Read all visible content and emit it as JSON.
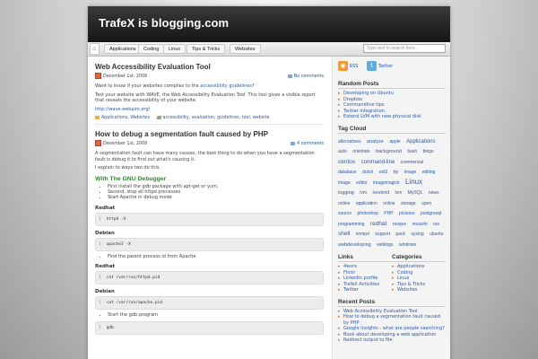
{
  "site": {
    "title": "TrafeX is blogging.com"
  },
  "nav": {
    "home_icon": "home-icon",
    "items": [
      "Applications",
      "Coding",
      "Linux",
      "Tips & Tricks",
      "Websites"
    ],
    "search_placeholder": "Type text to search here..."
  },
  "posts": [
    {
      "title": "Web Accessibility Evaluation Tool",
      "date": "December 1st, 2009",
      "comments": "No comments",
      "p1_before": "Want to know if your websites complies to the ",
      "p1_link": "accessibility guidelines",
      "p1_after": "?",
      "p2": "Test your website with WAVE, the Web Accessibility Evaluation Tool. This tool gives a visible report that reveals the accessibility of your website.",
      "url": "http://wave.webaim.org/",
      "categories": "Applications, Websites",
      "tags": "accessibility, evaluation, guidelines, tool, website"
    },
    {
      "title": "How to debug a segmentation fault caused by PHP",
      "date": "December 1st, 2009",
      "comments": "4 comments",
      "p1": "A segmentation fault can have many causes, the best thing to do when you have a segmentation fault is debug it to find out what's causing it.",
      "p2": "I explain to ways two do this.",
      "subheading": "With The GNU Debugger",
      "steps": [
        "First install the gdb package with apt-get or yum.",
        "Second, stop all httpd processes",
        "Start Apache in debug mode"
      ],
      "blocks": [
        {
          "label": "Redhat",
          "line": "1",
          "code": "httpd -X"
        },
        {
          "label": "Debian",
          "line": "1",
          "code": "apache2 -X"
        }
      ],
      "step_find": "Find the parent process id from Apache",
      "blocks2": [
        {
          "label": "Redhat",
          "line": "1",
          "code": "cat /var/run/httpd.pid"
        },
        {
          "label": "Debian",
          "line": "1",
          "code": "cat /var/run/apache.pid"
        }
      ],
      "step_gdb": "Start the gdb program",
      "block3": {
        "line": "1",
        "code": "gdb"
      }
    }
  ],
  "sidebar": {
    "rss_label": "RSS",
    "twitter_label": "Twitter",
    "recent_posts_title": "Random Posts",
    "random_posts": [
      "Developing on Ubuntu",
      "Dropbox",
      "Commandline tips",
      "Twitter integration",
      "Extend LVM with new physical disk"
    ],
    "tag_cloud_title": "Tag Cloud",
    "tags": [
      {
        "t": "alternatives",
        "s": 5
      },
      {
        "t": "analyze",
        "s": 5.5
      },
      {
        "t": "apple",
        "s": 5
      },
      {
        "t": "Applications",
        "s": 6
      },
      {
        "t": "auto",
        "s": 5
      },
      {
        "t": "orientate",
        "s": 5
      },
      {
        "t": "background",
        "s": 5.5
      },
      {
        "t": "bash",
        "s": 5
      },
      {
        "t": "blogs",
        "s": 5
      },
      {
        "t": "centos",
        "s": 6.5
      },
      {
        "t": "command-line",
        "s": 6
      },
      {
        "t": "commercial",
        "s": 5
      },
      {
        "t": "database",
        "s": 5
      },
      {
        "t": "dutch",
        "s": 5
      },
      {
        "t": "ext3",
        "s": 5
      },
      {
        "t": "hp",
        "s": 5
      },
      {
        "t": "image",
        "s": 5
      },
      {
        "t": "editing",
        "s": 5
      },
      {
        "t": "image",
        "s": 5
      },
      {
        "t": "editor",
        "s": 5
      },
      {
        "t": "imagemagick",
        "s": 5
      },
      {
        "t": "Linux",
        "s": 8
      },
      {
        "t": "logging",
        "s": 5.5
      },
      {
        "t": "lvm",
        "s": 5
      },
      {
        "t": "lvextend",
        "s": 5
      },
      {
        "t": "lvm",
        "s": 5
      },
      {
        "t": "MySQL",
        "s": 5
      },
      {
        "t": "news",
        "s": 5
      },
      {
        "t": "online",
        "s": 5
      },
      {
        "t": "application",
        "s": 5
      },
      {
        "t": "online",
        "s": 5
      },
      {
        "t": "storage",
        "s": 5
      },
      {
        "t": "open",
        "s": 5
      },
      {
        "t": "source",
        "s": 5
      },
      {
        "t": "photoshop",
        "s": 5
      },
      {
        "t": "PHP",
        "s": 5
      },
      {
        "t": "pictures",
        "s": 5
      },
      {
        "t": "postgresql",
        "s": 5
      },
      {
        "t": "programming",
        "s": 5
      },
      {
        "t": "redhat",
        "s": 6.5
      },
      {
        "t": "resque",
        "s": 5
      },
      {
        "t": "resizefs",
        "s": 5
      },
      {
        "t": "rss",
        "s": 5
      },
      {
        "t": "shell",
        "s": 6.5
      },
      {
        "t": "snmpd",
        "s": 5
      },
      {
        "t": "support",
        "s": 5
      },
      {
        "t": "pack",
        "s": 5
      },
      {
        "t": "syslog",
        "s": 5
      },
      {
        "t": "ubuntu",
        "s": 5
      },
      {
        "t": "webdeveloping",
        "s": 5.5
      },
      {
        "t": "weblogs",
        "s": 5
      },
      {
        "t": "windows",
        "s": 5
      }
    ],
    "links_title": "Links",
    "links": [
      "4worx",
      "Flickr",
      "LinkedIn profile",
      "TrafeX Activities",
      "Twitter"
    ],
    "categories_title": "Categories",
    "categories": [
      "Applications",
      "Coding",
      "Linux",
      "Tips & Tricks",
      "Websites"
    ],
    "recent_title": "Recent Posts",
    "recent": [
      "Web Accessibility Evaluation Tool",
      "How to debug a segmentation fault caused by PHP",
      "Google Insights - what are people searching?",
      "Book about developing a web application",
      "Redirect output to file"
    ]
  },
  "colors": {
    "accent_link": "#2a5aa8",
    "green_heading": "#2a8a2a",
    "header_dark": "#151515"
  }
}
